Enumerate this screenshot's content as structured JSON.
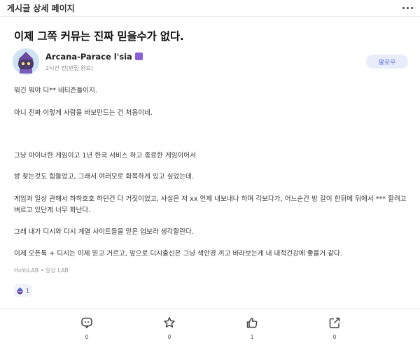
{
  "header": {
    "title": "게시글 상세 페이지",
    "more_icon": "more-horizontal-icon"
  },
  "post": {
    "title": "이제 그쪽 커뮤는 진짜 믿을수가 없다.",
    "author": {
      "name": "Arcana-Parace l'sia",
      "badge_icon": "purple-badge-icon",
      "time": "2시간 전(편집 완료)"
    },
    "follow_label": "팔로우",
    "paragraphs": [
      "뭐긴 뭐야 디** 네티즌들이지.",
      "아니 진짜 이렇게 사람을 바보만드는 건 처음이네.",
      "그냥 마이너한 게임이고 1년 한국 서비스 하고 종료한 게임이어서",
      "방 찾는것도 힘들었고, 그래서 여러모로 화목하게 있고 싶었는데.",
      "게임과 일상 관해서 하하호호 하던건 다 거짓이었고, 사실은 저 xx 언제 내보내나 하며 각보다가, 어느순간 방 갈이 한뒤에 뒤에서 *** 할려고 벼르고 있단게 너무 화난다.",
      "그래 내가 디시와 디시 계열 사이트들을 믿은 업보라 생각할란다.",
      "이제 오픈톡 + 디시는 이제 믿고 거르고, 앞으로 디시출신은 그냥 색안경 끼고 바라보는게 내 내적건강에 좋을거 같다."
    ],
    "source": "HoYoLAB • 일상 LAB",
    "reaction": {
      "icon": "character-emoji-icon",
      "count": "1"
    }
  },
  "actions": [
    {
      "name": "comment",
      "icon": "comment-icon",
      "count": "0"
    },
    {
      "name": "favorite",
      "icon": "star-icon",
      "count": "0"
    },
    {
      "name": "like",
      "icon": "thumbs-up-icon",
      "count": "1"
    },
    {
      "name": "share",
      "icon": "share-icon",
      "count": "0"
    }
  ],
  "colors": {
    "accent": "#5b73e8",
    "follow_bg": "#e9edfb",
    "badge": "#8b5fd6"
  }
}
